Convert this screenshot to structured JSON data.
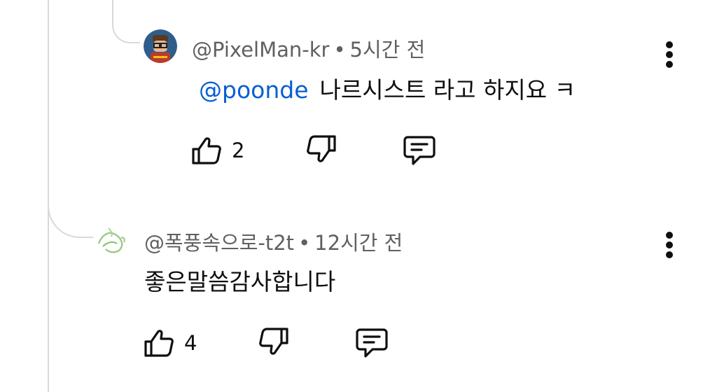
{
  "comments": [
    {
      "author": "@PixelMan-kr",
      "separator": "•",
      "time": "5시간 전",
      "mention": "@poonde",
      "text": "나르시스트 라고 하지요 ㅋ",
      "like_count": "2",
      "avatar_icon": "pixel-art-avatar"
    },
    {
      "author": "@폭풍속으로-t2t",
      "separator": "•",
      "time": "12시간 전",
      "text": "좋은말씀감사합니다",
      "like_count": "4",
      "avatar_icon": "green-sketch-avatar"
    }
  ],
  "icons": {
    "like": "thumbs-up-icon",
    "dislike": "thumbs-down-icon",
    "reply": "reply-comment-icon",
    "menu": "more-vertical-icon"
  },
  "colors": {
    "mention": "#065fd4",
    "meta_text": "#606060",
    "thread_line": "#d9d9d9"
  }
}
